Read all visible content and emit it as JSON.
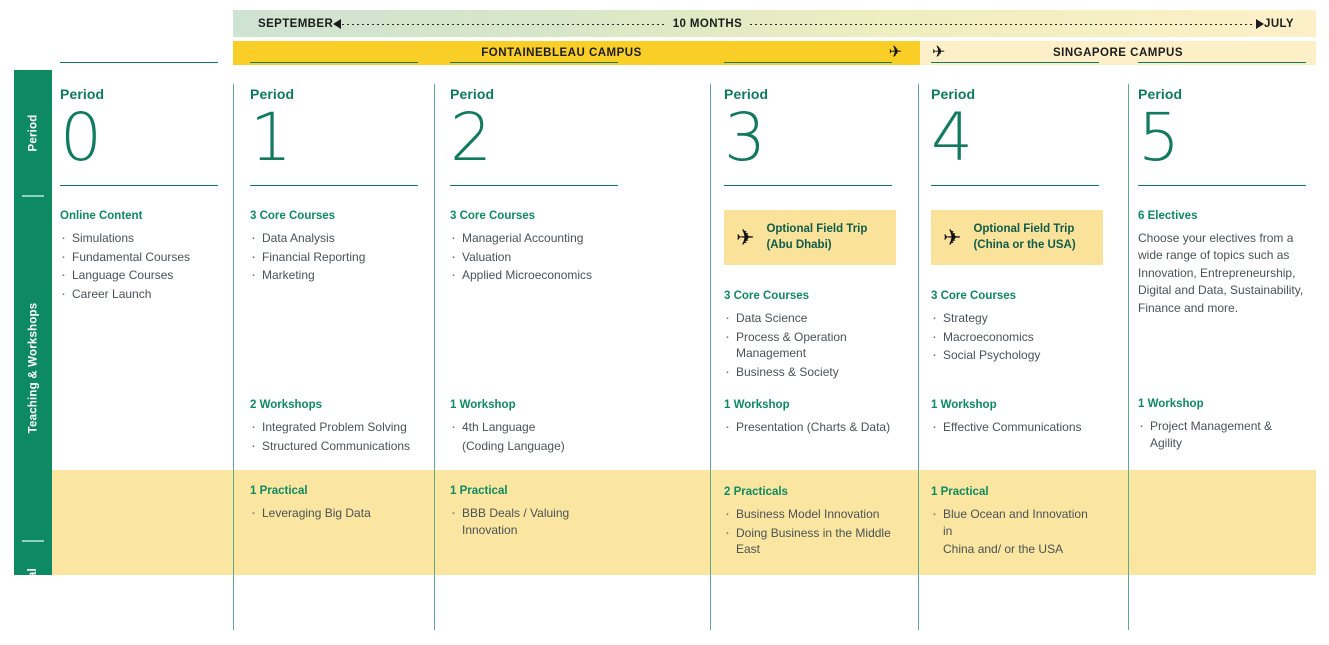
{
  "timeline": {
    "start_label": "SEPTEMBER",
    "duration_label": "10 MONTHS",
    "end_label": "JULY"
  },
  "campus_bar": {
    "left_campus": "FONTAINEBLEAU CAMPUS",
    "right_campus": "SINGAPORE CAMPUS",
    "icon_left": "airplane-icon",
    "icon_right": "airplane-icon"
  },
  "sidebar": {
    "sections": [
      {
        "label": "Period"
      },
      {
        "label": "Teaching & Workshops"
      },
      {
        "label": "Practical"
      }
    ]
  },
  "colors": {
    "green": "#0E8A62",
    "dark_green": "#0E7A5F",
    "yellow": "#F9CE26",
    "light_yellow": "#FDF0C8",
    "practical_band": "#FAE6A0",
    "fieldtrip_box": "#FBE29A"
  },
  "periods": [
    {
      "period_word": "Period",
      "number": "0",
      "teaching": [
        {
          "title": "Online Content",
          "items": [
            "Simulations",
            "Fundamental Courses",
            "Language Courses",
            "Career Launch"
          ]
        }
      ],
      "workshops": null,
      "practical": null
    },
    {
      "period_word": "Period",
      "number": "1",
      "teaching": [
        {
          "title": "3 Core Courses",
          "items": [
            "Data Analysis",
            "Financial Reporting",
            "Marketing"
          ]
        }
      ],
      "workshops": {
        "title": "2 Workshops",
        "items": [
          "Integrated Problem Solving",
          "Structured Communications"
        ]
      },
      "practical": {
        "title": "1 Practical",
        "items": [
          "Leveraging Big Data"
        ]
      }
    },
    {
      "period_word": "Period",
      "number": "2",
      "teaching": [
        {
          "title": "3 Core Courses",
          "items": [
            "Managerial Accounting",
            "Valuation",
            "Applied Microeconomics"
          ]
        }
      ],
      "workshops": {
        "title": "1 Workshop",
        "items": [
          "4th Language",
          "(Coding Language)"
        ]
      },
      "practical": {
        "title": "1 Practical",
        "items": [
          "BBB Deals / Valuing Innovation"
        ]
      }
    },
    {
      "period_word": "Period",
      "number": "3",
      "field_trip": {
        "line1": "Optional Field Trip",
        "line2": "(Abu Dhabi)",
        "icon": "airplane-icon"
      },
      "teaching": [
        {
          "title": "3 Core Courses",
          "items": [
            "Data Science",
            "Process & Operation Management",
            "Business & Society"
          ]
        }
      ],
      "workshops": {
        "title": "1 Workshop",
        "items": [
          "Presentation (Charts & Data)"
        ]
      },
      "practical": {
        "title": "2 Practicals",
        "items": [
          "Business Model Innovation",
          "Doing Business in the Middle East"
        ]
      }
    },
    {
      "period_word": "Period",
      "number": "4",
      "field_trip": {
        "line1": "Optional Field Trip",
        "line2": "(China or the USA)",
        "icon": "airplane-icon"
      },
      "teaching": [
        {
          "title": "3 Core Courses",
          "items": [
            "Strategy",
            "Macroeconomics",
            "Social Psychology"
          ]
        }
      ],
      "workshops": {
        "title": "1 Workshop",
        "items": [
          "Effective Communications"
        ]
      },
      "practical": {
        "title": "1 Practical",
        "items": [
          "Blue Ocean and Innovation in",
          "China and/ or the USA"
        ]
      }
    },
    {
      "period_word": "Period",
      "number": "5",
      "teaching": [
        {
          "title": "6 Electives",
          "paragraph": "Choose your electives from a wide range of topics such as Innovation, Entrepreneurship, Digital and Data, Sustainability, Finance and more."
        }
      ],
      "workshops": {
        "title": "1 Workshop",
        "items": [
          "Project Management & Agility"
        ]
      },
      "practical": null
    }
  ]
}
